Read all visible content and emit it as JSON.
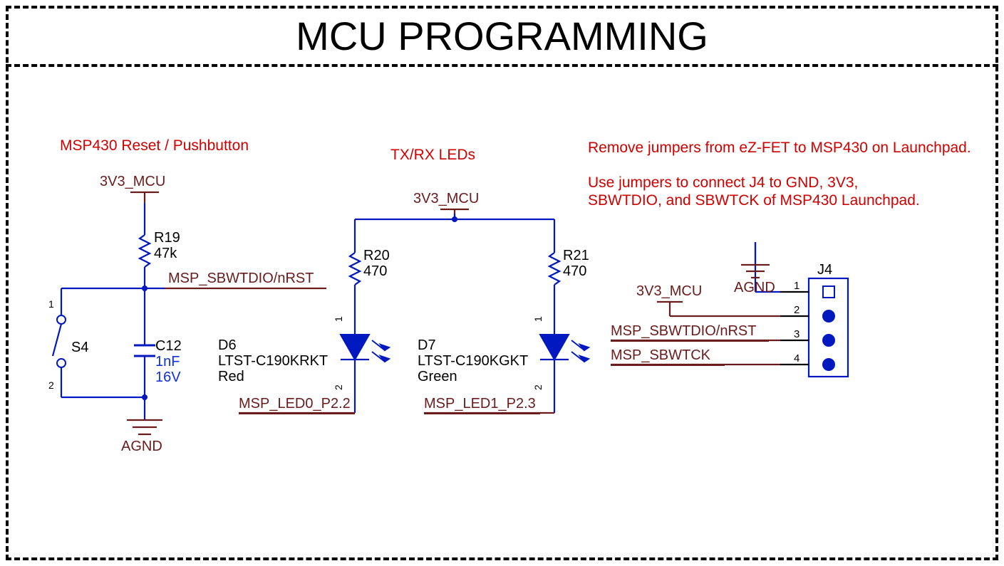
{
  "title": "MCU PROGRAMMING",
  "notes": {
    "resetTitle": "MSP430 Reset / Pushbutton",
    "ledsTitle": "TX/RX LEDs",
    "jumper1": "Remove jumpers from eZ-FET to MSP430 on Launchpad.",
    "jumper2": "Use jumpers to connect J4 to GND, 3V3,",
    "jumper3": "SBWTDIO, and SBWTCK of MSP430 Launchpad."
  },
  "power": {
    "v33_reset": "3V3_MCU",
    "v33_leds": "3V3_MCU",
    "v33_conn": "3V3_MCU",
    "agnd_reset": "AGND",
    "agnd_conn": "AGND"
  },
  "nets": {
    "sbwtdio": "MSP_SBWTDIO/nRST",
    "led0": "MSP_LED0_P2.2",
    "led1": "MSP_LED1_P2.3",
    "sbwtck": "MSP_SBWTCK"
  },
  "components": {
    "r19": {
      "ref": "R19",
      "val": "47k"
    },
    "r20": {
      "ref": "R20",
      "val": "470"
    },
    "r21": {
      "ref": "R21",
      "val": "470"
    },
    "c12": {
      "ref": "C12",
      "val": "1nF",
      "volt": "16V"
    },
    "s4": {
      "ref": "S4"
    },
    "d6": {
      "ref": "D6",
      "part": "LTST-C190KRKT",
      "color": "Red"
    },
    "d7": {
      "ref": "D7",
      "part": "LTST-C190KGKT",
      "color": "Green"
    },
    "j4": {
      "ref": "J4",
      "pins": [
        "1",
        "2",
        "3",
        "4"
      ]
    }
  }
}
